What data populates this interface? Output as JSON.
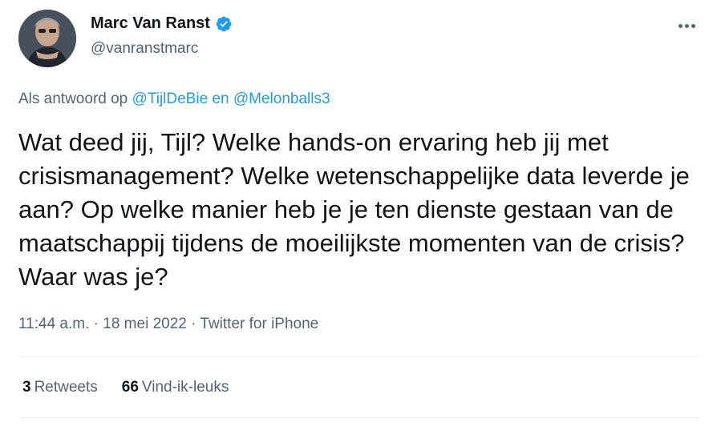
{
  "author": {
    "name": "Marc Van Ranst",
    "handle": "@vanranstmarc",
    "verified_color": "#1d9bf0"
  },
  "reply": {
    "prefix": "Als antwoord op",
    "user1": "@TijlDeBie",
    "joiner": "en",
    "user2": "@Melonballs3"
  },
  "tweet": {
    "text": "Wat deed jij, Tijl? Welke hands-on ervaring heb jij met crisismanagement? Welke wetenschappelijke data leverde je aan? Op welke manier heb je je ten dienste gestaan van de maatschappij tijdens de moeilijkste momenten van de crisis? Waar was je?"
  },
  "meta": {
    "time": "11:44 a.m.",
    "sep1": "·",
    "date": "18 mei 2022",
    "sep2": "·",
    "source": "Twitter for iPhone"
  },
  "stats": {
    "retweets_count": "3",
    "retweets_label": "Retweets",
    "likes_count": "66",
    "likes_label": "Vind-ik-leuks"
  }
}
